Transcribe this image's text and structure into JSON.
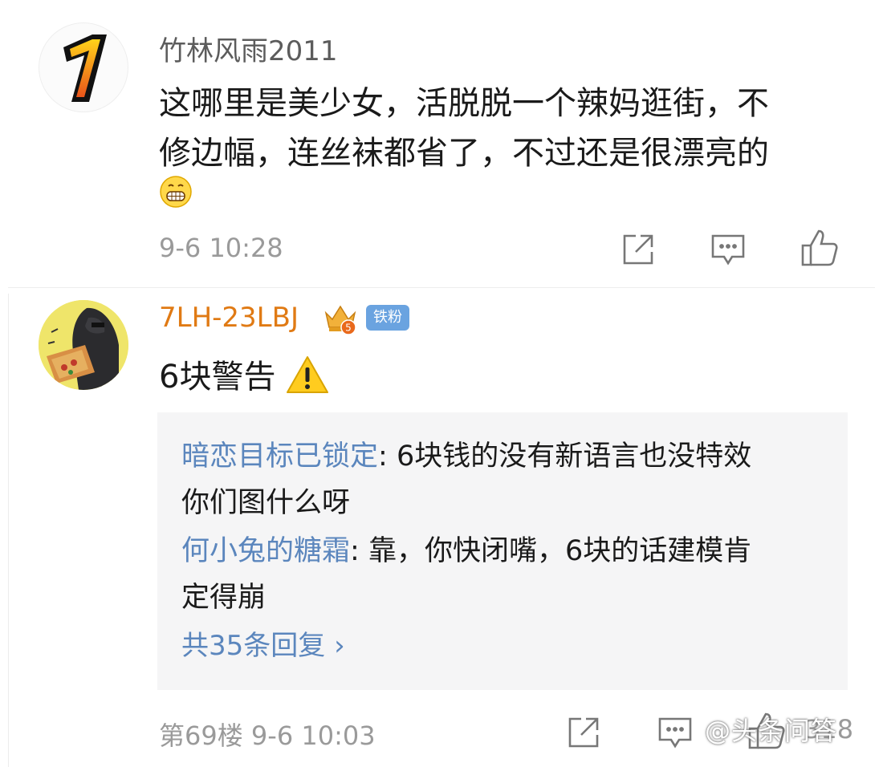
{
  "comments": [
    {
      "username": "竹林风雨2011",
      "text_line1": "这哪里是美少女，活脱脱一个辣妈逛街，不",
      "text_line2": "修边幅，连丝袜都省了，不过还是很漂亮的",
      "emoji": "grin-emoji",
      "timestamp": "9-6 10:28",
      "avatar_icon": "number-one-icon"
    },
    {
      "username": "7LH-23LBJ",
      "badge": "铁粉",
      "crown_level": "5",
      "text": "6块警告",
      "warning_icon": "warning-icon",
      "replies": [
        {
          "name": "暗恋目标已锁定",
          "sep": ": ",
          "text_line1": "6块钱的没有新语言也没特效",
          "text_line2": "你们图什么呀"
        },
        {
          "name": "何小兔的糖霜",
          "sep": ": ",
          "text_line1": "靠，你快闭嘴，6块的话建模肯",
          "text_line2": "定得崩"
        }
      ],
      "more_replies": "共35条回复 ›",
      "floor": "第69楼",
      "timestamp": "9-6 10:03",
      "like_count": "318"
    }
  ],
  "watermark": "@头条问答",
  "colors": {
    "link_blue": "#5b86bd",
    "username_orange": "#e07a14",
    "muted_gray": "#9a9a9a"
  }
}
